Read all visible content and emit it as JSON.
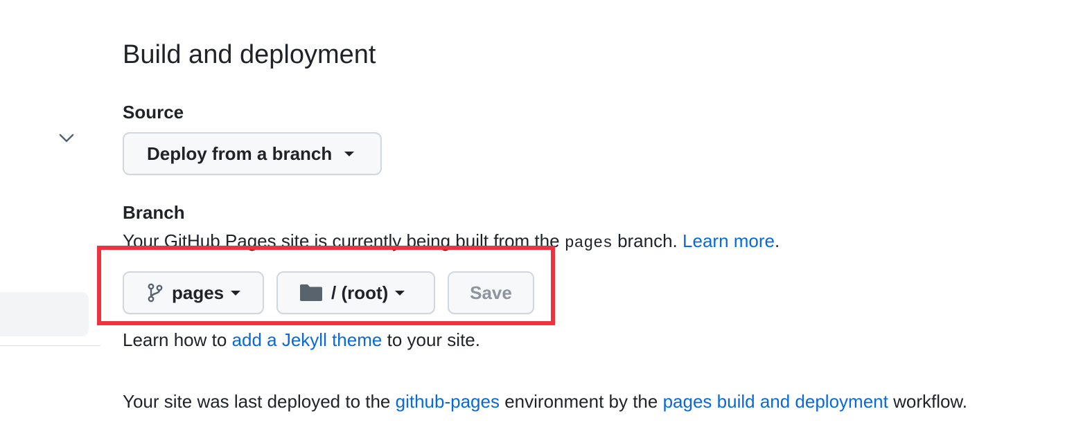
{
  "header": {
    "title": "Build and deployment"
  },
  "source": {
    "label": "Source",
    "dropdown_value": "Deploy from a branch"
  },
  "branch": {
    "label": "Branch",
    "description_prefix": "Your GitHub Pages site is currently being built from the",
    "branch_code": "pages",
    "description_suffix": "branch.",
    "learn_more": "Learn more",
    "period": ".",
    "branch_button": "pages",
    "folder_button": "/ (root)",
    "save_button": "Save"
  },
  "jekyll": {
    "prefix": "Learn how to",
    "link": "add a Jekyll theme",
    "suffix": "to your site."
  },
  "deployment": {
    "prefix": "Your site was last deployed to the",
    "environment_link": "github-pages",
    "middle": "environment by the",
    "workflow_link": "pages build and deployment",
    "suffix": "workflow."
  },
  "icons": {
    "sidebar_chevron": "chevron-down-icon",
    "branch": "git-branch-icon",
    "folder": "folder-icon",
    "caret": "triangle-down-icon"
  },
  "colors": {
    "link": "#0969da",
    "highlight": "#ee3340",
    "button_bg": "#f6f8fa",
    "button_border": "#d0d7de",
    "disabled_text": "#8c959f"
  }
}
